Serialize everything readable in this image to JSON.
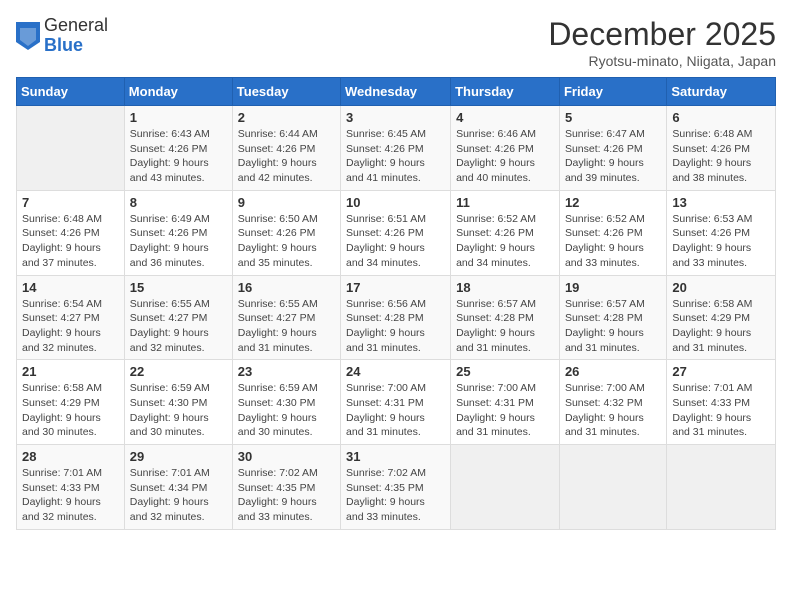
{
  "logo": {
    "general": "General",
    "blue": "Blue"
  },
  "title": "December 2025",
  "location": "Ryotsu-minato, Niigata, Japan",
  "days_of_week": [
    "Sunday",
    "Monday",
    "Tuesday",
    "Wednesday",
    "Thursday",
    "Friday",
    "Saturday"
  ],
  "weeks": [
    [
      {
        "day": "",
        "sunrise": "",
        "sunset": "",
        "daylight": ""
      },
      {
        "day": "1",
        "sunrise": "Sunrise: 6:43 AM",
        "sunset": "Sunset: 4:26 PM",
        "daylight": "Daylight: 9 hours and 43 minutes."
      },
      {
        "day": "2",
        "sunrise": "Sunrise: 6:44 AM",
        "sunset": "Sunset: 4:26 PM",
        "daylight": "Daylight: 9 hours and 42 minutes."
      },
      {
        "day": "3",
        "sunrise": "Sunrise: 6:45 AM",
        "sunset": "Sunset: 4:26 PM",
        "daylight": "Daylight: 9 hours and 41 minutes."
      },
      {
        "day": "4",
        "sunrise": "Sunrise: 6:46 AM",
        "sunset": "Sunset: 4:26 PM",
        "daylight": "Daylight: 9 hours and 40 minutes."
      },
      {
        "day": "5",
        "sunrise": "Sunrise: 6:47 AM",
        "sunset": "Sunset: 4:26 PM",
        "daylight": "Daylight: 9 hours and 39 minutes."
      },
      {
        "day": "6",
        "sunrise": "Sunrise: 6:48 AM",
        "sunset": "Sunset: 4:26 PM",
        "daylight": "Daylight: 9 hours and 38 minutes."
      }
    ],
    [
      {
        "day": "7",
        "sunrise": "Sunrise: 6:48 AM",
        "sunset": "Sunset: 4:26 PM",
        "daylight": "Daylight: 9 hours and 37 minutes."
      },
      {
        "day": "8",
        "sunrise": "Sunrise: 6:49 AM",
        "sunset": "Sunset: 4:26 PM",
        "daylight": "Daylight: 9 hours and 36 minutes."
      },
      {
        "day": "9",
        "sunrise": "Sunrise: 6:50 AM",
        "sunset": "Sunset: 4:26 PM",
        "daylight": "Daylight: 9 hours and 35 minutes."
      },
      {
        "day": "10",
        "sunrise": "Sunrise: 6:51 AM",
        "sunset": "Sunset: 4:26 PM",
        "daylight": "Daylight: 9 hours and 34 minutes."
      },
      {
        "day": "11",
        "sunrise": "Sunrise: 6:52 AM",
        "sunset": "Sunset: 4:26 PM",
        "daylight": "Daylight: 9 hours and 34 minutes."
      },
      {
        "day": "12",
        "sunrise": "Sunrise: 6:52 AM",
        "sunset": "Sunset: 4:26 PM",
        "daylight": "Daylight: 9 hours and 33 minutes."
      },
      {
        "day": "13",
        "sunrise": "Sunrise: 6:53 AM",
        "sunset": "Sunset: 4:26 PM",
        "daylight": "Daylight: 9 hours and 33 minutes."
      }
    ],
    [
      {
        "day": "14",
        "sunrise": "Sunrise: 6:54 AM",
        "sunset": "Sunset: 4:27 PM",
        "daylight": "Daylight: 9 hours and 32 minutes."
      },
      {
        "day": "15",
        "sunrise": "Sunrise: 6:55 AM",
        "sunset": "Sunset: 4:27 PM",
        "daylight": "Daylight: 9 hours and 32 minutes."
      },
      {
        "day": "16",
        "sunrise": "Sunrise: 6:55 AM",
        "sunset": "Sunset: 4:27 PM",
        "daylight": "Daylight: 9 hours and 31 minutes."
      },
      {
        "day": "17",
        "sunrise": "Sunrise: 6:56 AM",
        "sunset": "Sunset: 4:28 PM",
        "daylight": "Daylight: 9 hours and 31 minutes."
      },
      {
        "day": "18",
        "sunrise": "Sunrise: 6:57 AM",
        "sunset": "Sunset: 4:28 PM",
        "daylight": "Daylight: 9 hours and 31 minutes."
      },
      {
        "day": "19",
        "sunrise": "Sunrise: 6:57 AM",
        "sunset": "Sunset: 4:28 PM",
        "daylight": "Daylight: 9 hours and 31 minutes."
      },
      {
        "day": "20",
        "sunrise": "Sunrise: 6:58 AM",
        "sunset": "Sunset: 4:29 PM",
        "daylight": "Daylight: 9 hours and 31 minutes."
      }
    ],
    [
      {
        "day": "21",
        "sunrise": "Sunrise: 6:58 AM",
        "sunset": "Sunset: 4:29 PM",
        "daylight": "Daylight: 9 hours and 30 minutes."
      },
      {
        "day": "22",
        "sunrise": "Sunrise: 6:59 AM",
        "sunset": "Sunset: 4:30 PM",
        "daylight": "Daylight: 9 hours and 30 minutes."
      },
      {
        "day": "23",
        "sunrise": "Sunrise: 6:59 AM",
        "sunset": "Sunset: 4:30 PM",
        "daylight": "Daylight: 9 hours and 30 minutes."
      },
      {
        "day": "24",
        "sunrise": "Sunrise: 7:00 AM",
        "sunset": "Sunset: 4:31 PM",
        "daylight": "Daylight: 9 hours and 31 minutes."
      },
      {
        "day": "25",
        "sunrise": "Sunrise: 7:00 AM",
        "sunset": "Sunset: 4:31 PM",
        "daylight": "Daylight: 9 hours and 31 minutes."
      },
      {
        "day": "26",
        "sunrise": "Sunrise: 7:00 AM",
        "sunset": "Sunset: 4:32 PM",
        "daylight": "Daylight: 9 hours and 31 minutes."
      },
      {
        "day": "27",
        "sunrise": "Sunrise: 7:01 AM",
        "sunset": "Sunset: 4:33 PM",
        "daylight": "Daylight: 9 hours and 31 minutes."
      }
    ],
    [
      {
        "day": "28",
        "sunrise": "Sunrise: 7:01 AM",
        "sunset": "Sunset: 4:33 PM",
        "daylight": "Daylight: 9 hours and 32 minutes."
      },
      {
        "day": "29",
        "sunrise": "Sunrise: 7:01 AM",
        "sunset": "Sunset: 4:34 PM",
        "daylight": "Daylight: 9 hours and 32 minutes."
      },
      {
        "day": "30",
        "sunrise": "Sunrise: 7:02 AM",
        "sunset": "Sunset: 4:35 PM",
        "daylight": "Daylight: 9 hours and 33 minutes."
      },
      {
        "day": "31",
        "sunrise": "Sunrise: 7:02 AM",
        "sunset": "Sunset: 4:35 PM",
        "daylight": "Daylight: 9 hours and 33 minutes."
      },
      {
        "day": "",
        "sunrise": "",
        "sunset": "",
        "daylight": ""
      },
      {
        "day": "",
        "sunrise": "",
        "sunset": "",
        "daylight": ""
      },
      {
        "day": "",
        "sunrise": "",
        "sunset": "",
        "daylight": ""
      }
    ]
  ]
}
